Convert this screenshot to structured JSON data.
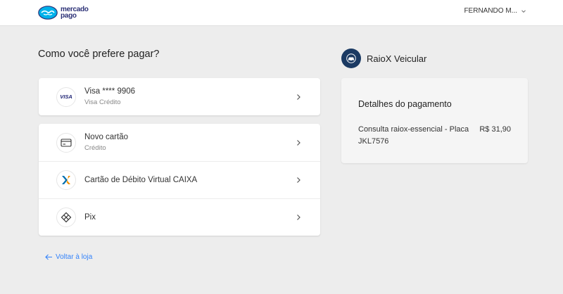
{
  "header": {
    "brand_line1": "mercado",
    "brand_line2": "pago",
    "user_name": "FERNANDO M...",
    "icons": {
      "logo": "handshake-logo-icon",
      "user_menu": "chevron-down-icon"
    }
  },
  "main": {
    "title": "Como você prefere pagar?",
    "saved_card": {
      "title": "Visa **** 9906",
      "subtitle": "Visa Crédito",
      "brand_badge": "VISA"
    },
    "options": [
      {
        "title": "Novo cartão",
        "subtitle": "Crédito",
        "icon": "credit-card-icon"
      },
      {
        "title": "Cartão de Débito Virtual CAIXA",
        "subtitle": "",
        "icon": "caixa-logo-icon"
      },
      {
        "title": "Pix",
        "subtitle": "",
        "icon": "pix-icon"
      }
    ],
    "back_link": "Voltar à loja"
  },
  "sidebar": {
    "merchant_name": "RaioX Veicular",
    "summary": {
      "title": "Detalhes do pagamento",
      "item_description": "Consulta raiox-essencial - Placa JKL7576",
      "item_price": "R$ 31,90"
    }
  },
  "colors": {
    "background": "#ededed",
    "link": "#3483fa",
    "brand_navy": "#2d3277",
    "brand_cyan": "#00b1ea",
    "merchant_bg": "#1b3a63",
    "caixa_orange": "#f39200",
    "caixa_blue": "#0070af"
  }
}
